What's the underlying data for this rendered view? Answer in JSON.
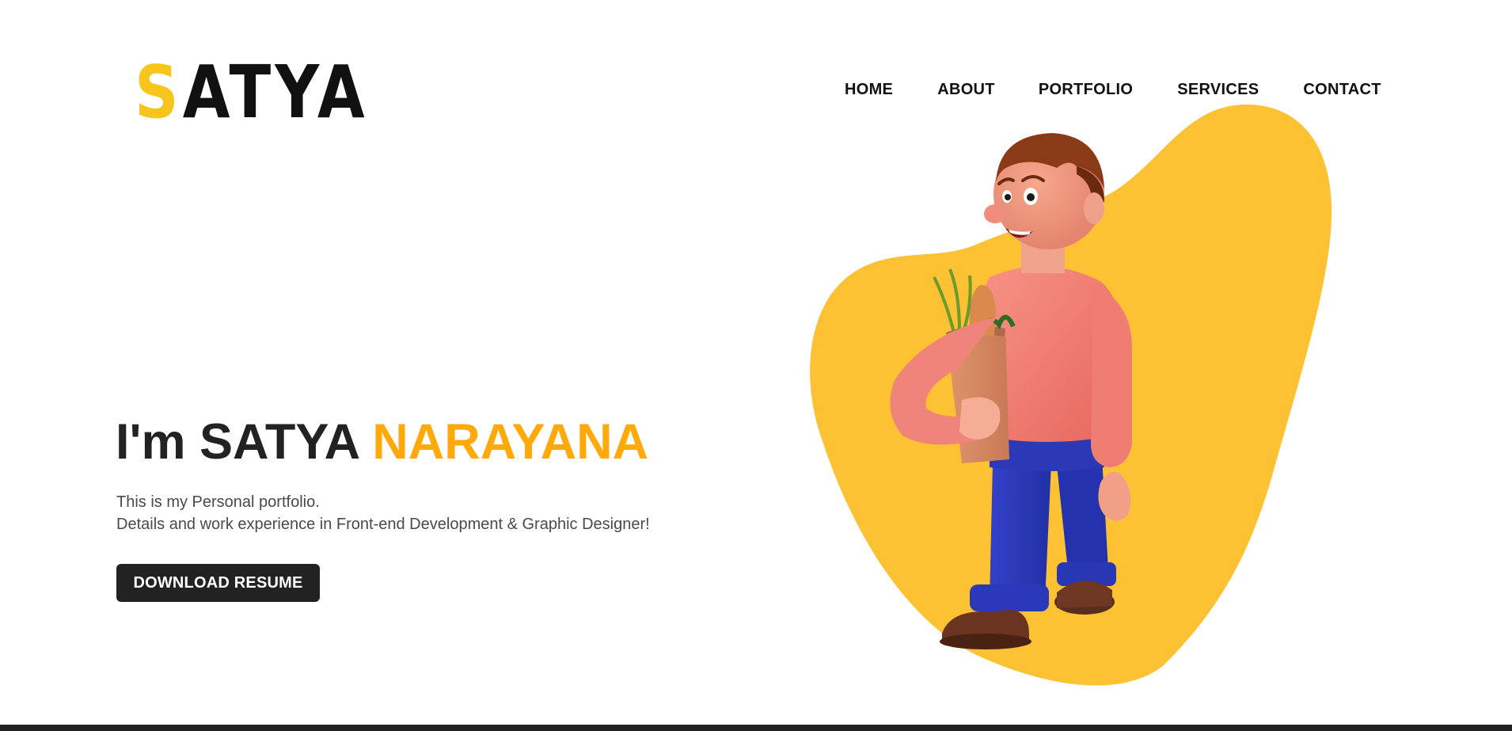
{
  "logo": {
    "first_letter": "S",
    "rest": "ATYA"
  },
  "nav": {
    "items": [
      {
        "label": "HOME"
      },
      {
        "label": "ABOUT"
      },
      {
        "label": "PORTFOLIO"
      },
      {
        "label": "SERVICES"
      },
      {
        "label": "CONTACT"
      }
    ]
  },
  "hero": {
    "greeting": "I'm SATYA ",
    "name_highlight": "NARAYANA",
    "description_line1": "This is my Personal portfolio.",
    "description_line2": "Details and work experience in Front-end Development & Graphic Designer!",
    "button_label": "DOWNLOAD RESUME"
  },
  "colors": {
    "accent_yellow": "#f8c51c",
    "accent_orange": "#ffa90a",
    "blob_yellow": "#fdc134",
    "dark": "#222222"
  },
  "illustration": {
    "subject": "3d-character-with-grocery-bag",
    "icon": "person-with-grocery-bag-illustration"
  }
}
